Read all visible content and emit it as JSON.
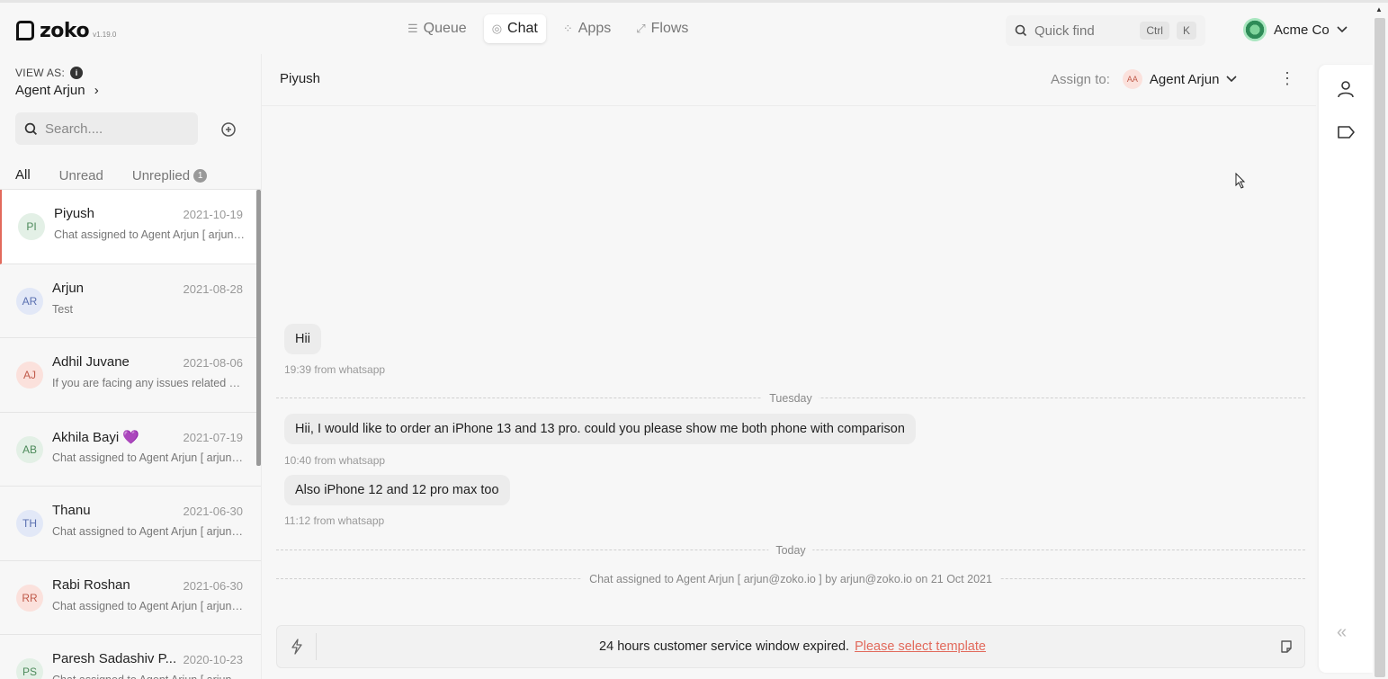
{
  "topbar": {
    "brand": "zoko",
    "version": "v1.19.0",
    "nav": [
      {
        "label": "Queue",
        "icon": "queue-icon"
      },
      {
        "label": "Chat",
        "icon": "chat-icon",
        "active": true
      },
      {
        "label": "Apps",
        "icon": "apps-icon"
      },
      {
        "label": "Flows",
        "icon": "flows-icon"
      }
    ],
    "quickfind": {
      "label": "Quick find",
      "key1": "Ctrl",
      "key2": "K"
    },
    "account": {
      "name": "Acme Co"
    }
  },
  "sidebar": {
    "view_as_label": "VIEW AS:",
    "view_as_agent": "Agent Arjun",
    "search_placeholder": "Search....",
    "tabs": [
      {
        "label": "All",
        "active": true
      },
      {
        "label": "Unread"
      },
      {
        "label": "Unreplied",
        "badge": "1"
      }
    ],
    "chats": [
      {
        "initials": "PI",
        "name": "Piyush",
        "date": "2021-10-19",
        "preview": "Chat assigned to Agent Arjun [ arjun@zoko.io ]",
        "avatar_bg": "#e3f0e6",
        "avatar_fg": "#4d8a5b",
        "selected": true
      },
      {
        "initials": "AR",
        "name": "Arjun",
        "date": "2021-08-28",
        "preview": "Test",
        "avatar_bg": "#e2e8f7",
        "avatar_fg": "#5a70b0"
      },
      {
        "initials": "AJ",
        "name": "Adhil Juvane",
        "date": "2021-08-06",
        "preview": "If you are facing any issues related to your order",
        "avatar_bg": "#fbe1dc",
        "avatar_fg": "#c05a4a"
      },
      {
        "initials": "AB",
        "name": "Akhila Bayi 💜",
        "date": "2021-07-19",
        "preview": "Chat assigned to Agent Arjun [ arjun@zoko.io ]",
        "avatar_bg": "#e3f0e6",
        "avatar_fg": "#4d8a5b"
      },
      {
        "initials": "TH",
        "name": "Thanu",
        "date": "2021-06-30",
        "preview": "Chat assigned to Agent Arjun [ arjun@zoko.io ]",
        "avatar_bg": "#e2e8f7",
        "avatar_fg": "#5a70b0"
      },
      {
        "initials": "RR",
        "name": "Rabi Roshan",
        "date": "2021-06-30",
        "preview": "Chat assigned to Agent Arjun [ arjun@zoko.io ]",
        "avatar_bg": "#fbe1dc",
        "avatar_fg": "#c05a4a"
      },
      {
        "initials": "PS",
        "name": "Paresh Sadashiv P...",
        "date": "2020-10-23",
        "preview": "Chat assigned to Agent Arjun [ arjun@zoko.io ]",
        "avatar_bg": "#e3f0e6",
        "avatar_fg": "#4d8a5b"
      }
    ]
  },
  "conversation": {
    "contact_name": "Piyush",
    "assign_label": "Assign to:",
    "assignee_initials": "AA",
    "assignee_name": "Agent Arjun",
    "messages": [
      {
        "text": "Hii",
        "meta": "19:39 from whatsapp"
      },
      {
        "text": "Hii, I would like to order an iPhone 13 and 13 pro. could you please show me both phone with comparison",
        "meta": "10:40 from whatsapp"
      },
      {
        "text": "Also iPhone 12 and 12 pro max too",
        "meta": "11:12 from whatsapp"
      }
    ],
    "dividers": {
      "tuesday": "Tuesday",
      "today": "Today"
    },
    "system_note": "Chat assigned to Agent Arjun [ arjun@zoko.io ] by arjun@zoko.io on 21 Oct 2021",
    "composer": {
      "notice": "24 hours customer service window expired.",
      "link": "Please select template"
    }
  },
  "colors": {
    "accent": "#e26a5c"
  }
}
